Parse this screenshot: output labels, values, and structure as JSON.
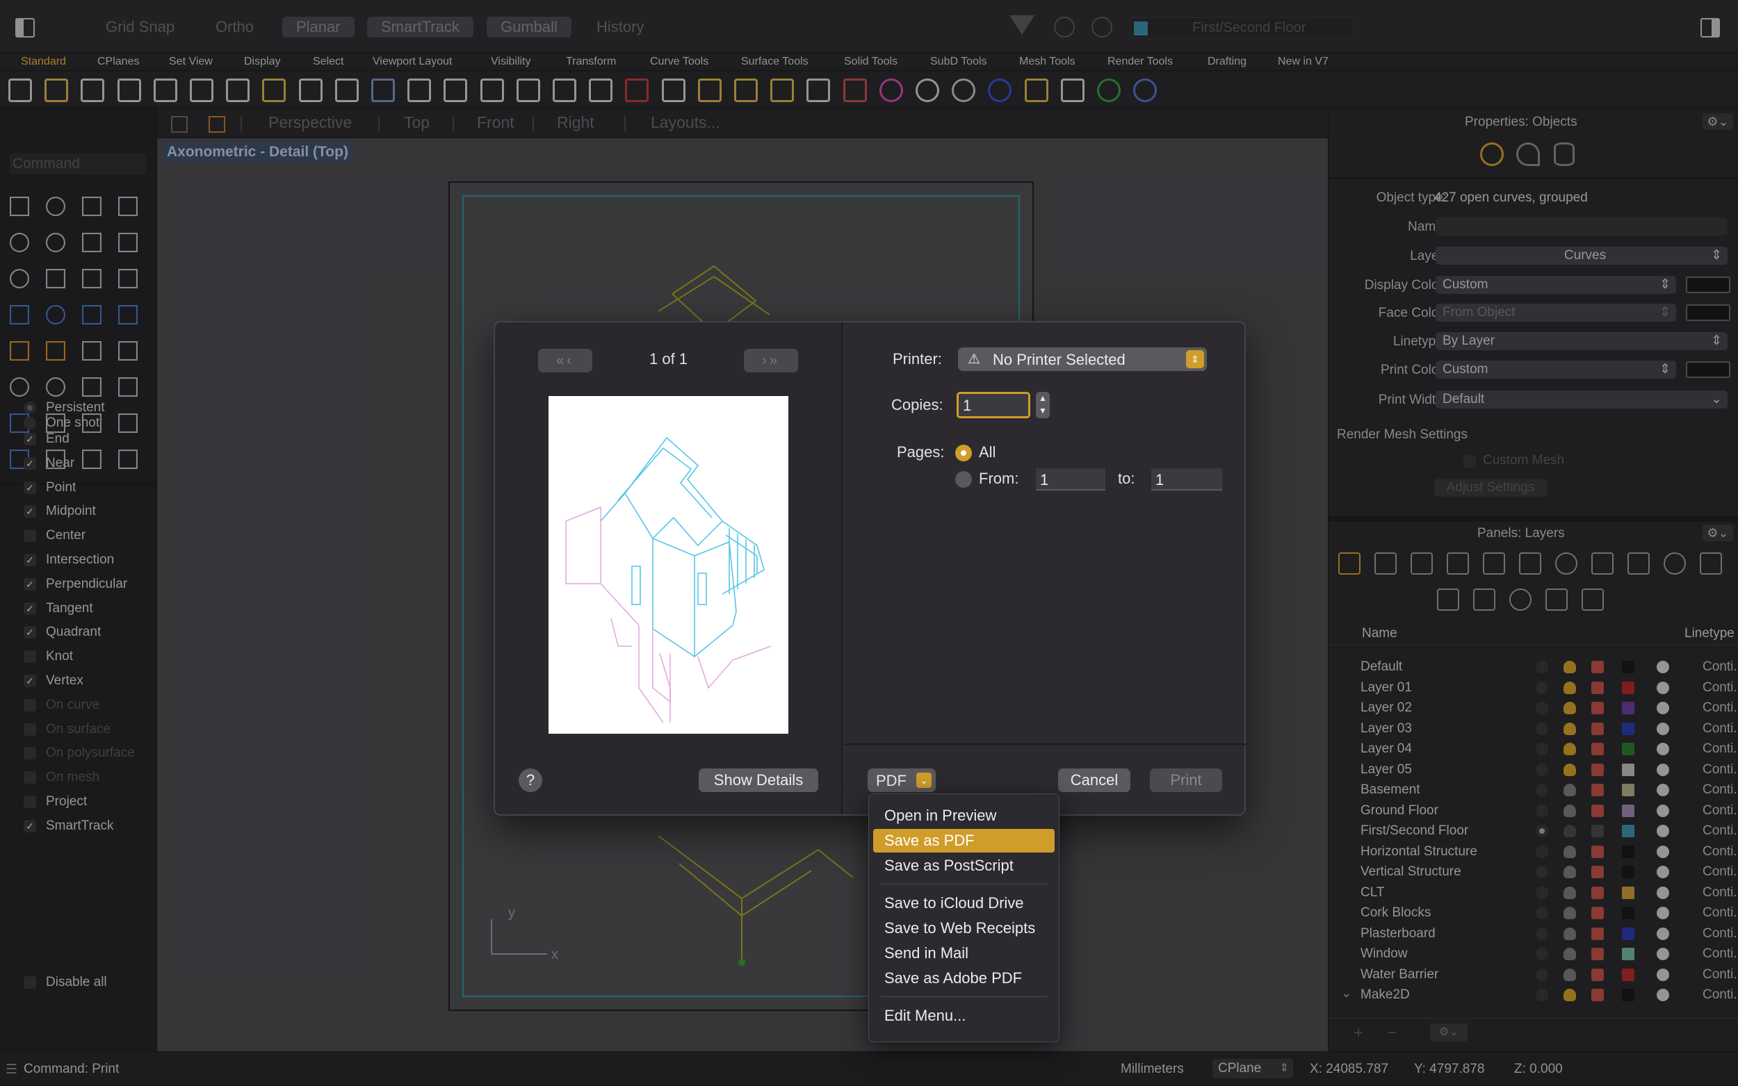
{
  "topbar": {
    "grid_snap": "Grid Snap",
    "ortho": "Ortho",
    "planar": "Planar",
    "smarttrack": "SmartTrack",
    "gumball": "Gumball",
    "history": "History",
    "layer_select": "First/Second Floor"
  },
  "tabs": [
    "Standard",
    "CPlanes",
    "Set View",
    "Display",
    "Select",
    "Viewport Layout",
    "Visibility",
    "Transform",
    "Curve Tools",
    "Surface Tools",
    "Solid Tools",
    "SubD Tools",
    "Mesh Tools",
    "Render Tools",
    "Drafting",
    "New in V7"
  ],
  "viewtabs": [
    "Perspective",
    "Top",
    "Front",
    "Right",
    "Layouts..."
  ],
  "viewport": {
    "label": "Axonometric - Detail (Top)",
    "axis_y": "y",
    "axis_x": "x"
  },
  "command": {
    "placeholder": "Command"
  },
  "snaps": {
    "modes": [
      "Persistent",
      "One shot"
    ],
    "items": [
      {
        "label": "End",
        "checked": true,
        "enabled": true
      },
      {
        "label": "Near",
        "checked": true,
        "enabled": true
      },
      {
        "label": "Point",
        "checked": true,
        "enabled": true
      },
      {
        "label": "Midpoint",
        "checked": true,
        "enabled": true
      },
      {
        "label": "Center",
        "checked": false,
        "enabled": true
      },
      {
        "label": "Intersection",
        "checked": true,
        "enabled": true
      },
      {
        "label": "Perpendicular",
        "checked": true,
        "enabled": true
      },
      {
        "label": "Tangent",
        "checked": true,
        "enabled": true
      },
      {
        "label": "Quadrant",
        "checked": true,
        "enabled": true
      },
      {
        "label": "Knot",
        "checked": false,
        "enabled": true
      },
      {
        "label": "Vertex",
        "checked": true,
        "enabled": true
      },
      {
        "label": "On curve",
        "checked": false,
        "enabled": false
      },
      {
        "label": "On surface",
        "checked": false,
        "enabled": false
      },
      {
        "label": "On polysurface",
        "checked": false,
        "enabled": false
      },
      {
        "label": "On mesh",
        "checked": false,
        "enabled": false
      },
      {
        "label": "Project",
        "checked": false,
        "enabled": true
      },
      {
        "label": "SmartTrack",
        "checked": true,
        "enabled": true
      }
    ],
    "disable_all": "Disable all"
  },
  "properties": {
    "title": "Properties: Objects",
    "object_type_label": "Object type:",
    "object_type_value": "427 open curves, grouped",
    "name_label": "Name:",
    "layer_label": "Layer:",
    "layer_value": "Curves",
    "display_color_label": "Display Color:",
    "display_color_value": "Custom",
    "face_color_label": "Face Color:",
    "face_color_value": "From Object",
    "linetype_label": "Linetype:",
    "linetype_value": "By Layer",
    "print_color_label": "Print Color:",
    "print_color_value": "Custom",
    "print_width_label": "Print Width:",
    "print_width_value": "Default",
    "render_mesh": "Render Mesh Settings",
    "custom_mesh": "Custom Mesh",
    "adjust_settings": "Adjust Settings"
  },
  "layers": {
    "title": "Panels: Layers",
    "col_name": "Name",
    "col_linetype": "Linetype",
    "rows": [
      {
        "name": "Default",
        "color": "#1a1a1a",
        "lt": "Conti..."
      },
      {
        "name": "Layer 01",
        "color": "#b3262a",
        "lt": "Conti..."
      },
      {
        "name": "Layer 02",
        "color": "#6b3f9c",
        "lt": "Conti..."
      },
      {
        "name": "Layer 03",
        "color": "#2a3fa8",
        "lt": "Conti..."
      },
      {
        "name": "Layer 04",
        "color": "#2f7a2f",
        "lt": "Conti..."
      },
      {
        "name": "Layer 05",
        "color": "#bdbdbd",
        "lt": "Conti..."
      },
      {
        "name": "Basement",
        "color": "#b0ad86",
        "lt": "Conti..."
      },
      {
        "name": "Ground Floor",
        "color": "#9b86ad",
        "lt": "Conti..."
      },
      {
        "name": "First/Second Floor",
        "color": "#3d8fa8",
        "lt": "Conti..."
      },
      {
        "name": "Horizontal Structure",
        "color": "#1a1a1a",
        "lt": "Conti..."
      },
      {
        "name": "Vertical Structure",
        "color": "#1a1a1a",
        "lt": "Conti..."
      },
      {
        "name": "CLT",
        "color": "#c79a3a",
        "lt": "Conti..."
      },
      {
        "name": "Cork Blocks",
        "color": "#1a1a1a",
        "lt": "Conti..."
      },
      {
        "name": "Plasterboard",
        "color": "#2f3ab0",
        "lt": "Conti..."
      },
      {
        "name": "Window",
        "color": "#6fb89a",
        "lt": "Conti..."
      },
      {
        "name": "Water Barrier",
        "color": "#b32a2a",
        "lt": "Conti..."
      },
      {
        "name": "Make2D",
        "color": "#1a1a1a",
        "lt": "Conti..."
      }
    ]
  },
  "print_dialog": {
    "page_indicator": "1 of 1",
    "printer_label": "Printer:",
    "printer_value": "No Printer Selected",
    "copies_label": "Copies:",
    "copies_value": "1",
    "pages_label": "Pages:",
    "pages_all": "All",
    "pages_from": "From:",
    "from_value": "1",
    "to_label": "to:",
    "to_value": "1",
    "help": "?",
    "show_details": "Show Details",
    "pdf": "PDF",
    "cancel": "Cancel",
    "print": "Print"
  },
  "pdf_menu": {
    "items": [
      "Open in Preview",
      "Save as PDF",
      "Save as PostScript",
      "Save to iCloud Drive",
      "Save to Web Receipts",
      "Send in Mail",
      "Save as Adobe PDF",
      "Edit Menu..."
    ],
    "selected": "Save as PDF"
  },
  "status": {
    "command": "Command: Print",
    "units": "Millimeters",
    "cplane": "CPlane",
    "x": "X: 24085.787",
    "y": "Y: 4797.878",
    "z": "Z: 0.000"
  },
  "colors": {
    "accent": "#d09d2a",
    "preview_line": "#4cc3e6",
    "preview_pink": "#e3a6dc"
  }
}
